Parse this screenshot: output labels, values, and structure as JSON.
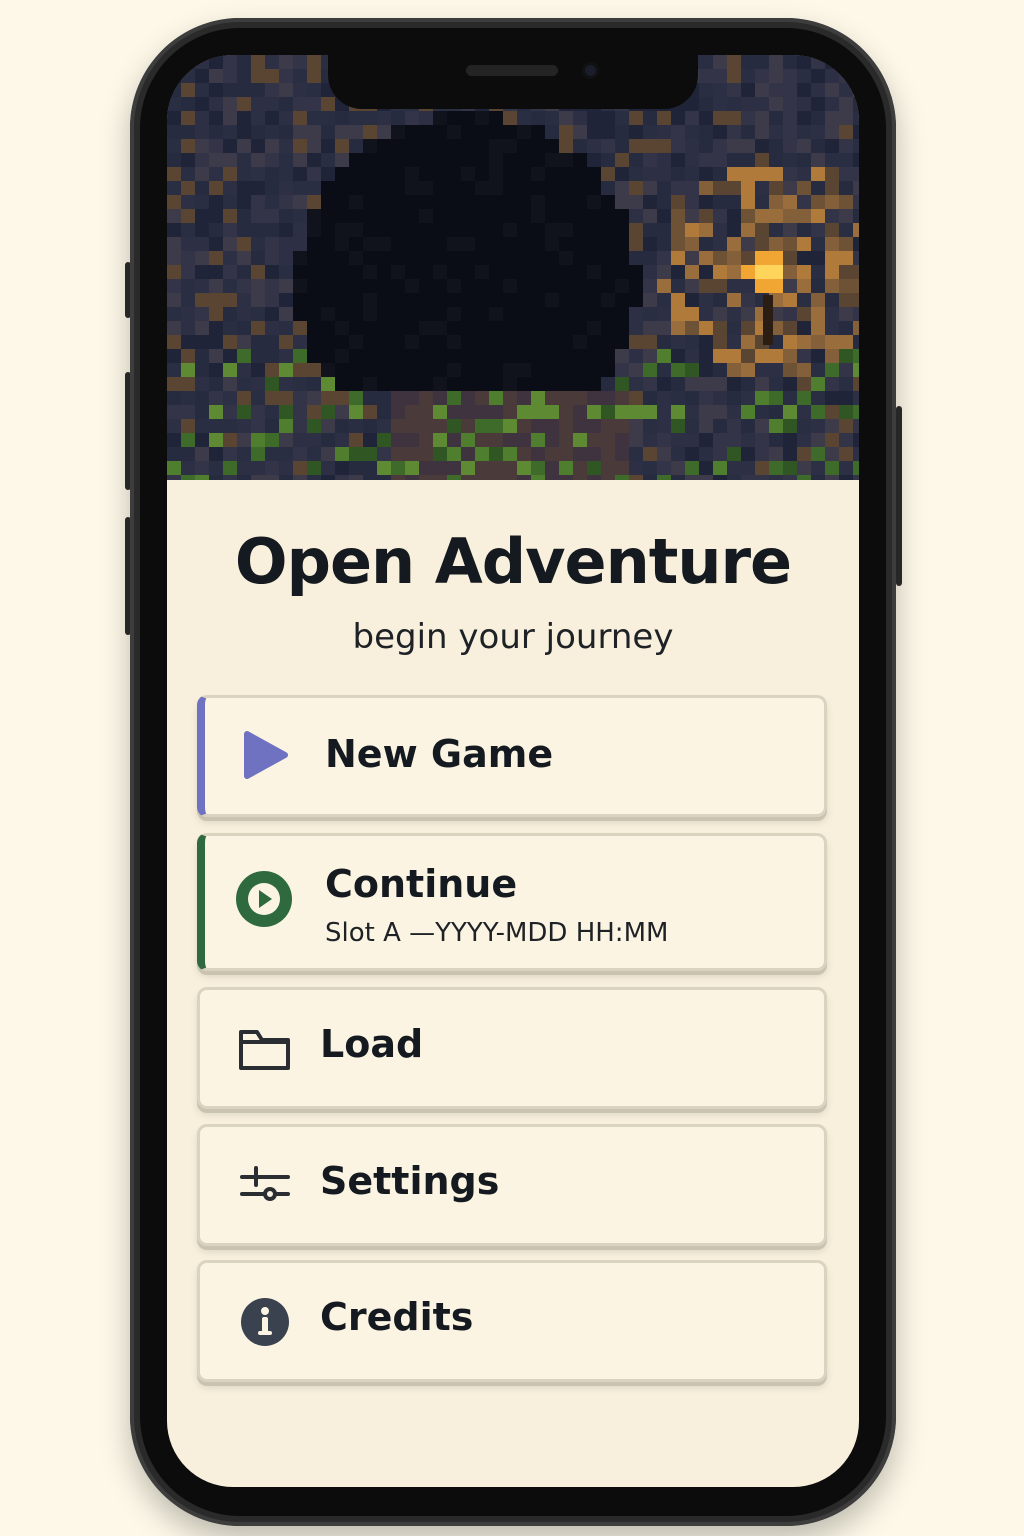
{
  "app": {
    "title": "Open Adventure",
    "subtitle": "begin your journey"
  },
  "menu": {
    "new_game": {
      "label": "New Game",
      "icon": "play-triangle-icon",
      "accent": "#6f72c0"
    },
    "continue": {
      "label": "Continue",
      "sublabel": "Slot A —YYYY-MDD HH:MM",
      "icon": "play-circle-icon",
      "accent": "#2f6a3f"
    },
    "load": {
      "label": "Load",
      "icon": "folder-icon"
    },
    "settings": {
      "label": "Settings",
      "icon": "sliders-icon"
    },
    "credits": {
      "label": "Credits",
      "icon": "info-icon"
    }
  },
  "hero": {
    "scene": "pixel-art cave entrance with torch"
  },
  "colors": {
    "background": "#fdf8e8",
    "panel": "#f8f0dc",
    "text": "#141a1f",
    "button_fill": "#fbf4e2",
    "button_border": "#d9d3c0"
  }
}
